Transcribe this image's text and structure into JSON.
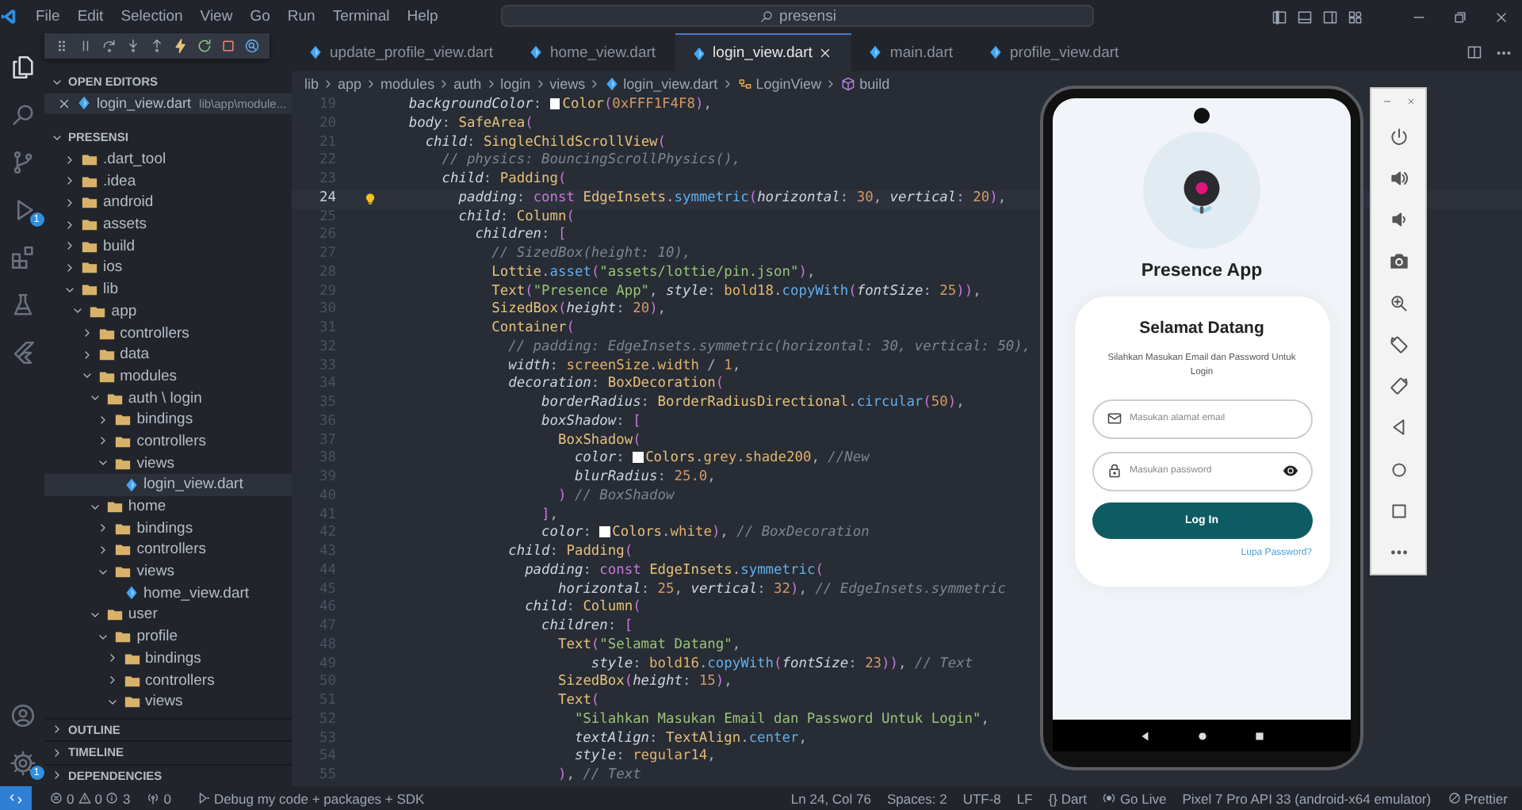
{
  "title_bar": {
    "menu": [
      "File",
      "Edit",
      "Selection",
      "View",
      "Go",
      "Run",
      "Terminal",
      "Help"
    ],
    "search": "presensi"
  },
  "activity_bar": {
    "debug_badge": "1",
    "settings_badge": "1"
  },
  "sidebar": {
    "open_editors": {
      "title": "OPEN EDITORS",
      "expanded": true,
      "items": [
        {
          "name": "login_view.dart",
          "path": "lib\\app\\module...",
          "selected": true
        }
      ]
    },
    "folder": {
      "title": "PRESENSI",
      "expanded": true,
      "items": [
        {
          "label": ".dart_tool",
          "kind": "folder",
          "expanded": false,
          "selected": false
        },
        {
          "label": ".idea",
          "kind": "folder",
          "expanded": false,
          "selected": false
        },
        {
          "label": "android",
          "kind": "folder",
          "expanded": false,
          "selected": false
        },
        {
          "label": "assets",
          "kind": "folder",
          "expanded": false,
          "selected": false
        },
        {
          "label": "build",
          "kind": "folder",
          "expanded": false,
          "selected": false
        },
        {
          "label": "ios",
          "kind": "folder",
          "expanded": false,
          "selected": false
        },
        {
          "label": "lib",
          "kind": "folder",
          "expanded": true,
          "selected": false,
          "children": [
            {
              "label": "app",
              "kind": "folder",
              "expanded": true,
              "selected": false,
              "children": [
                {
                  "label": "controllers",
                  "kind": "folder",
                  "expanded": false,
                  "selected": false
                },
                {
                  "label": "data",
                  "kind": "folder",
                  "expanded": false,
                  "selected": false
                },
                {
                  "label": "modules",
                  "kind": "folder",
                  "expanded": true,
                  "selected": false,
                  "children": [
                    {
                      "label": "auth \\ login",
                      "kind": "folder",
                      "expanded": true,
                      "selected": false,
                      "children": [
                        {
                          "label": "bindings",
                          "kind": "folder",
                          "expanded": false,
                          "selected": false
                        },
                        {
                          "label": "controllers",
                          "kind": "folder",
                          "expanded": false,
                          "selected": false
                        },
                        {
                          "label": "views",
                          "kind": "folder",
                          "expanded": true,
                          "selected": false,
                          "children": [
                            {
                              "label": "login_view.dart",
                              "kind": "file",
                              "selected": true
                            }
                          ]
                        }
                      ]
                    },
                    {
                      "label": "home",
                      "kind": "folder",
                      "expanded": true,
                      "selected": false,
                      "children": [
                        {
                          "label": "bindings",
                          "kind": "folder",
                          "expanded": false,
                          "selected": false
                        },
                        {
                          "label": "controllers",
                          "kind": "folder",
                          "expanded": false,
                          "selected": false
                        },
                        {
                          "label": "views",
                          "kind": "folder",
                          "expanded": true,
                          "selected": false,
                          "children": [
                            {
                              "label": "home_view.dart",
                              "kind": "file",
                              "selected": false
                            }
                          ]
                        }
                      ]
                    },
                    {
                      "label": "user",
                      "kind": "folder",
                      "expanded": true,
                      "selected": false,
                      "children": [
                        {
                          "label": "profile",
                          "kind": "folder",
                          "expanded": true,
                          "selected": false,
                          "children": [
                            {
                              "label": "bindings",
                              "kind": "folder",
                              "expanded": false,
                              "selected": false
                            },
                            {
                              "label": "controllers",
                              "kind": "folder",
                              "expanded": false,
                              "selected": false
                            },
                            {
                              "label": "views",
                              "kind": "folder",
                              "expanded": true,
                              "selected": false
                            }
                          ]
                        }
                      ]
                    }
                  ]
                }
              ]
            }
          ]
        }
      ]
    },
    "sections": [
      {
        "title": "OUTLINE",
        "expanded": false
      },
      {
        "title": "TIMELINE",
        "expanded": false
      },
      {
        "title": "DEPENDENCIES",
        "expanded": false
      }
    ]
  },
  "editor": {
    "tabs": [
      {
        "label": "update_profile_view.dart",
        "selected": false
      },
      {
        "label": "home_view.dart",
        "selected": false
      },
      {
        "label": "login_view.dart",
        "selected": true
      },
      {
        "label": "main.dart",
        "selected": false
      },
      {
        "label": "profile_view.dart",
        "selected": false
      }
    ],
    "breadcrumbs": [
      {
        "label": "lib",
        "kind": "folder"
      },
      {
        "label": "app",
        "kind": "folder"
      },
      {
        "label": "modules",
        "kind": "folder"
      },
      {
        "label": "auth",
        "kind": "folder"
      },
      {
        "label": "login",
        "kind": "folder"
      },
      {
        "label": "views",
        "kind": "folder"
      },
      {
        "label": "login_view.dart",
        "kind": "file"
      },
      {
        "label": "LoginView",
        "kind": "class"
      },
      {
        "label": "build",
        "kind": "method"
      }
    ],
    "lines": [
      {
        "number": "19",
        "current": false,
        "tokens": [
          {
            "text": "        backgroundColor",
            "kind": "prop"
          },
          {
            "text": ": ",
            "kind": "punct"
          },
          {
            "kind": "swatch"
          },
          {
            "text": "Color",
            "kind": "class"
          },
          {
            "text": "(",
            "kind": "bracket"
          },
          {
            "text": "0xFFF1F4F8",
            "kind": "number"
          },
          {
            "text": ")",
            "kind": "bracket"
          },
          {
            "text": ",",
            "kind": "punct"
          }
        ]
      },
      {
        "number": "20",
        "current": false,
        "tokens": [
          {
            "text": "        body",
            "kind": "prop"
          },
          {
            "text": ": ",
            "kind": "punct"
          },
          {
            "text": "SafeArea",
            "kind": "class"
          },
          {
            "text": "(",
            "kind": "bracket"
          }
        ]
      },
      {
        "number": "21",
        "current": false,
        "tokens": [
          {
            "text": "          child",
            "kind": "prop"
          },
          {
            "text": ": ",
            "kind": "punct"
          },
          {
            "text": "SingleChildScrollView",
            "kind": "class"
          },
          {
            "text": "(",
            "kind": "bracket"
          }
        ]
      },
      {
        "number": "22",
        "current": false,
        "tokens": [
          {
            "text": "            // physics: BouncingScrollPhysics(),",
            "kind": "comment"
          }
        ]
      },
      {
        "number": "23",
        "current": false,
        "tokens": [
          {
            "text": "            child",
            "kind": "prop"
          },
          {
            "text": ": ",
            "kind": "punct"
          },
          {
            "text": "Padding",
            "kind": "class"
          },
          {
            "text": "(",
            "kind": "bracket"
          }
        ]
      },
      {
        "number": "24",
        "current": true,
        "tokens": [
          {
            "text": "              padding",
            "kind": "prop"
          },
          {
            "text": ": ",
            "kind": "punct"
          },
          {
            "text": "const ",
            "kind": "keyword"
          },
          {
            "text": "EdgeInsets",
            "kind": "class"
          },
          {
            "text": ".",
            "kind": "punct"
          },
          {
            "text": "symmetric",
            "kind": "method"
          },
          {
            "text": "(",
            "kind": "bracket"
          },
          {
            "text": "horizontal",
            "kind": "prop"
          },
          {
            "text": ": ",
            "kind": "punct"
          },
          {
            "text": "30",
            "kind": "number"
          },
          {
            "text": ", ",
            "kind": "punct"
          },
          {
            "text": "vertical",
            "kind": "prop"
          },
          {
            "text": ": ",
            "kind": "punct"
          },
          {
            "text": "20",
            "kind": "number"
          },
          {
            "text": ")",
            "kind": "bracket"
          },
          {
            "text": ",",
            "kind": "punct"
          }
        ]
      },
      {
        "number": "25",
        "current": false,
        "tokens": [
          {
            "text": "              child",
            "kind": "prop"
          },
          {
            "text": ": ",
            "kind": "punct"
          },
          {
            "text": "Column",
            "kind": "class"
          },
          {
            "text": "(",
            "kind": "bracket"
          }
        ]
      },
      {
        "number": "26",
        "current": false,
        "tokens": [
          {
            "text": "                children",
            "kind": "prop"
          },
          {
            "text": ": ",
            "kind": "punct"
          },
          {
            "text": "[",
            "kind": "bracket"
          }
        ]
      },
      {
        "number": "27",
        "current": false,
        "tokens": [
          {
            "text": "                  // SizedBox(height: 10),",
            "kind": "comment"
          }
        ]
      },
      {
        "number": "28",
        "current": false,
        "tokens": [
          {
            "text": "                  Lottie",
            "kind": "class"
          },
          {
            "text": ".",
            "kind": "punct"
          },
          {
            "text": "asset",
            "kind": "method"
          },
          {
            "text": "(",
            "kind": "bracket"
          },
          {
            "text": "\"assets/lottie/pin.json\"",
            "kind": "string"
          },
          {
            "text": ")",
            "kind": "bracket"
          },
          {
            "text": ",",
            "kind": "punct"
          }
        ]
      },
      {
        "number": "29",
        "current": false,
        "tokens": [
          {
            "text": "                  Text",
            "kind": "class"
          },
          {
            "text": "(",
            "kind": "bracket"
          },
          {
            "text": "\"Presence App\"",
            "kind": "string"
          },
          {
            "text": ", ",
            "kind": "punct"
          },
          {
            "text": "style",
            "kind": "prop"
          },
          {
            "text": ": ",
            "kind": "punct"
          },
          {
            "text": "bold18",
            "kind": "var"
          },
          {
            "text": ".",
            "kind": "punct"
          },
          {
            "text": "copyWith",
            "kind": "method"
          },
          {
            "text": "(",
            "kind": "bracket"
          },
          {
            "text": "fontSize",
            "kind": "prop"
          },
          {
            "text": ": ",
            "kind": "punct"
          },
          {
            "text": "25",
            "kind": "number"
          },
          {
            "text": "))",
            "kind": "bracket"
          },
          {
            "text": ",",
            "kind": "punct"
          }
        ]
      },
      {
        "number": "30",
        "current": false,
        "tokens": [
          {
            "text": "                  SizedBox",
            "kind": "class"
          },
          {
            "text": "(",
            "kind": "bracket"
          },
          {
            "text": "height",
            "kind": "prop"
          },
          {
            "text": ": ",
            "kind": "punct"
          },
          {
            "text": "20",
            "kind": "number"
          },
          {
            "text": ")",
            "kind": "bracket"
          },
          {
            "text": ",",
            "kind": "punct"
          }
        ]
      },
      {
        "number": "31",
        "current": false,
        "tokens": [
          {
            "text": "                  Container",
            "kind": "class"
          },
          {
            "text": "(",
            "kind": "bracket"
          }
        ]
      },
      {
        "number": "32",
        "current": false,
        "tokens": [
          {
            "text": "                    // padding: EdgeInsets.symmetric(horizontal: 30, vertical: 50),",
            "kind": "comment"
          }
        ]
      },
      {
        "number": "33",
        "current": false,
        "tokens": [
          {
            "text": "                    width",
            "kind": "prop"
          },
          {
            "text": ": ",
            "kind": "punct"
          },
          {
            "text": "screenSize",
            "kind": "var"
          },
          {
            "text": ".",
            "kind": "punct"
          },
          {
            "text": "width",
            "kind": "var"
          },
          {
            "text": " / ",
            "kind": "punct"
          },
          {
            "text": "1",
            "kind": "number"
          },
          {
            "text": ",",
            "kind": "punct"
          }
        ]
      },
      {
        "number": "34",
        "current": false,
        "tokens": [
          {
            "text": "                    decoration",
            "kind": "prop"
          },
          {
            "text": ": ",
            "kind": "punct"
          },
          {
            "text": "BoxDecoration",
            "kind": "class"
          },
          {
            "text": "(",
            "kind": "bracket"
          }
        ]
      },
      {
        "number": "35",
        "current": false,
        "tokens": [
          {
            "text": "                        borderRadius",
            "kind": "prop"
          },
          {
            "text": ": ",
            "kind": "punct"
          },
          {
            "text": "BorderRadiusDirectional",
            "kind": "class"
          },
          {
            "text": ".",
            "kind": "punct"
          },
          {
            "text": "circular",
            "kind": "method"
          },
          {
            "text": "(",
            "kind": "bracket"
          },
          {
            "text": "50",
            "kind": "number"
          },
          {
            "text": ")",
            "kind": "bracket"
          },
          {
            "text": ",",
            "kind": "punct"
          }
        ]
      },
      {
        "number": "36",
        "current": false,
        "tokens": [
          {
            "text": "                        boxShadow",
            "kind": "prop"
          },
          {
            "text": ": ",
            "kind": "punct"
          },
          {
            "text": "[",
            "kind": "bracket"
          }
        ]
      },
      {
        "number": "37",
        "current": false,
        "tokens": [
          {
            "text": "                          BoxShadow",
            "kind": "class"
          },
          {
            "text": "(",
            "kind": "bracket"
          }
        ]
      },
      {
        "number": "38",
        "current": false,
        "tokens": [
          {
            "text": "                            color",
            "kind": "prop"
          },
          {
            "text": ": ",
            "kind": "punct"
          },
          {
            "kind": "swatch"
          },
          {
            "text": "Colors",
            "kind": "class"
          },
          {
            "text": ".",
            "kind": "punct"
          },
          {
            "text": "grey",
            "kind": "var"
          },
          {
            "text": ".",
            "kind": "punct"
          },
          {
            "text": "shade200",
            "kind": "var"
          },
          {
            "text": ", ",
            "kind": "punct"
          },
          {
            "text": "//New",
            "kind": "comment"
          }
        ]
      },
      {
        "number": "39",
        "current": false,
        "tokens": [
          {
            "text": "                            blurRadius",
            "kind": "prop"
          },
          {
            "text": ": ",
            "kind": "punct"
          },
          {
            "text": "25.0",
            "kind": "number"
          },
          {
            "text": ",",
            "kind": "punct"
          }
        ]
      },
      {
        "number": "40",
        "current": false,
        "tokens": [
          {
            "text": "                          )",
            "kind": "bracket"
          },
          {
            "text": " // BoxShadow",
            "kind": "comment"
          }
        ]
      },
      {
        "number": "41",
        "current": false,
        "tokens": [
          {
            "text": "                        ]",
            "kind": "bracket"
          },
          {
            "text": ",",
            "kind": "punct"
          }
        ]
      },
      {
        "number": "42",
        "current": false,
        "tokens": [
          {
            "text": "                        color",
            "kind": "prop"
          },
          {
            "text": ": ",
            "kind": "punct"
          },
          {
            "kind": "swatch"
          },
          {
            "text": "Colors",
            "kind": "class"
          },
          {
            "text": ".",
            "kind": "punct"
          },
          {
            "text": "white",
            "kind": "var"
          },
          {
            "text": ")",
            "kind": "bracket"
          },
          {
            "text": ", ",
            "kind": "punct"
          },
          {
            "text": "// BoxDecoration",
            "kind": "comment"
          }
        ]
      },
      {
        "number": "43",
        "current": false,
        "tokens": [
          {
            "text": "                    child",
            "kind": "prop"
          },
          {
            "text": ": ",
            "kind": "punct"
          },
          {
            "text": "Padding",
            "kind": "class"
          },
          {
            "text": "(",
            "kind": "bracket"
          }
        ]
      },
      {
        "number": "44",
        "current": false,
        "tokens": [
          {
            "text": "                      padding",
            "kind": "prop"
          },
          {
            "text": ": ",
            "kind": "punct"
          },
          {
            "text": "const ",
            "kind": "keyword"
          },
          {
            "text": "EdgeInsets",
            "kind": "class"
          },
          {
            "text": ".",
            "kind": "punct"
          },
          {
            "text": "symmetric",
            "kind": "method"
          },
          {
            "text": "(",
            "kind": "bracket"
          }
        ]
      },
      {
        "number": "45",
        "current": false,
        "tokens": [
          {
            "text": "                          horizontal",
            "kind": "prop"
          },
          {
            "text": ": ",
            "kind": "punct"
          },
          {
            "text": "25",
            "kind": "number"
          },
          {
            "text": ", ",
            "kind": "punct"
          },
          {
            "text": "vertical",
            "kind": "prop"
          },
          {
            "text": ": ",
            "kind": "punct"
          },
          {
            "text": "32",
            "kind": "number"
          },
          {
            "text": ")",
            "kind": "bracket"
          },
          {
            "text": ", ",
            "kind": "punct"
          },
          {
            "text": "// EdgeInsets.symmetric",
            "kind": "comment"
          }
        ]
      },
      {
        "number": "46",
        "current": false,
        "tokens": [
          {
            "text": "                      child",
            "kind": "prop"
          },
          {
            "text": ": ",
            "kind": "punct"
          },
          {
            "text": "Column",
            "kind": "class"
          },
          {
            "text": "(",
            "kind": "bracket"
          }
        ]
      },
      {
        "number": "47",
        "current": false,
        "tokens": [
          {
            "text": "                        children",
            "kind": "prop"
          },
          {
            "text": ": ",
            "kind": "punct"
          },
          {
            "text": "[",
            "kind": "bracket"
          }
        ]
      },
      {
        "number": "48",
        "current": false,
        "tokens": [
          {
            "text": "                          Text",
            "kind": "class"
          },
          {
            "text": "(",
            "kind": "bracket"
          },
          {
            "text": "\"Selamat Datang\"",
            "kind": "string"
          },
          {
            "text": ",",
            "kind": "punct"
          }
        ]
      },
      {
        "number": "49",
        "current": false,
        "tokens": [
          {
            "text": "                              style",
            "kind": "prop"
          },
          {
            "text": ": ",
            "kind": "punct"
          },
          {
            "text": "bold16",
            "kind": "var"
          },
          {
            "text": ".",
            "kind": "punct"
          },
          {
            "text": "copyWith",
            "kind": "method"
          },
          {
            "text": "(",
            "kind": "bracket"
          },
          {
            "text": "fontSize",
            "kind": "prop"
          },
          {
            "text": ": ",
            "kind": "punct"
          },
          {
            "text": "23",
            "kind": "number"
          },
          {
            "text": "))",
            "kind": "bracket"
          },
          {
            "text": ", ",
            "kind": "punct"
          },
          {
            "text": "// Text",
            "kind": "comment"
          }
        ]
      },
      {
        "number": "50",
        "current": false,
        "tokens": [
          {
            "text": "                          SizedBox",
            "kind": "class"
          },
          {
            "text": "(",
            "kind": "bracket"
          },
          {
            "text": "height",
            "kind": "prop"
          },
          {
            "text": ": ",
            "kind": "punct"
          },
          {
            "text": "15",
            "kind": "number"
          },
          {
            "text": ")",
            "kind": "bracket"
          },
          {
            "text": ",",
            "kind": "punct"
          }
        ]
      },
      {
        "number": "51",
        "current": false,
        "tokens": [
          {
            "text": "                          Text",
            "kind": "class"
          },
          {
            "text": "(",
            "kind": "bracket"
          }
        ]
      },
      {
        "number": "52",
        "current": false,
        "tokens": [
          {
            "text": "                            \"Silahkan Masukan Email dan Password Untuk Login\"",
            "kind": "string"
          },
          {
            "text": ",",
            "kind": "punct"
          }
        ]
      },
      {
        "number": "53",
        "current": false,
        "tokens": [
          {
            "text": "                            textAlign",
            "kind": "prop"
          },
          {
            "text": ": ",
            "kind": "punct"
          },
          {
            "text": "TextAlign",
            "kind": "class"
          },
          {
            "text": ".",
            "kind": "punct"
          },
          {
            "text": "center",
            "kind": "method"
          },
          {
            "text": ",",
            "kind": "punct"
          }
        ]
      },
      {
        "number": "54",
        "current": false,
        "tokens": [
          {
            "text": "                            style",
            "kind": "prop"
          },
          {
            "text": ": ",
            "kind": "punct"
          },
          {
            "text": "regular14",
            "kind": "var"
          },
          {
            "text": ",",
            "kind": "punct"
          }
        ]
      },
      {
        "number": "55",
        "current": false,
        "tokens": [
          {
            "text": "                          )",
            "kind": "bracket"
          },
          {
            "text": ", ",
            "kind": "punct"
          },
          {
            "text": "// Text",
            "kind": "comment"
          }
        ]
      }
    ]
  },
  "emulator": {
    "app_title": "Presence App",
    "card_title": "Selamat Datang",
    "card_subtitle": "Silahkan Masukan Email dan Password Untuk Login",
    "email_placeholder": "Masukan alamat email",
    "password_placeholder": "Masukan password",
    "login_button": "Log In",
    "forgot_password": "Lupa Password?"
  },
  "status_bar": {
    "errors": "0",
    "warnings": "0",
    "infos": "3",
    "ports": "0",
    "debug_target": "Debug my code + packages + SDK",
    "position": "Ln 24, Col 76",
    "indentation": "Spaces: 2",
    "encoding": "UTF-8",
    "eol": "LF",
    "language": "{} Dart",
    "go_live": "Go Live",
    "device": "Pixel 7 Pro API 33 (android-x64 emulator)",
    "formatter": "Prettier"
  }
}
